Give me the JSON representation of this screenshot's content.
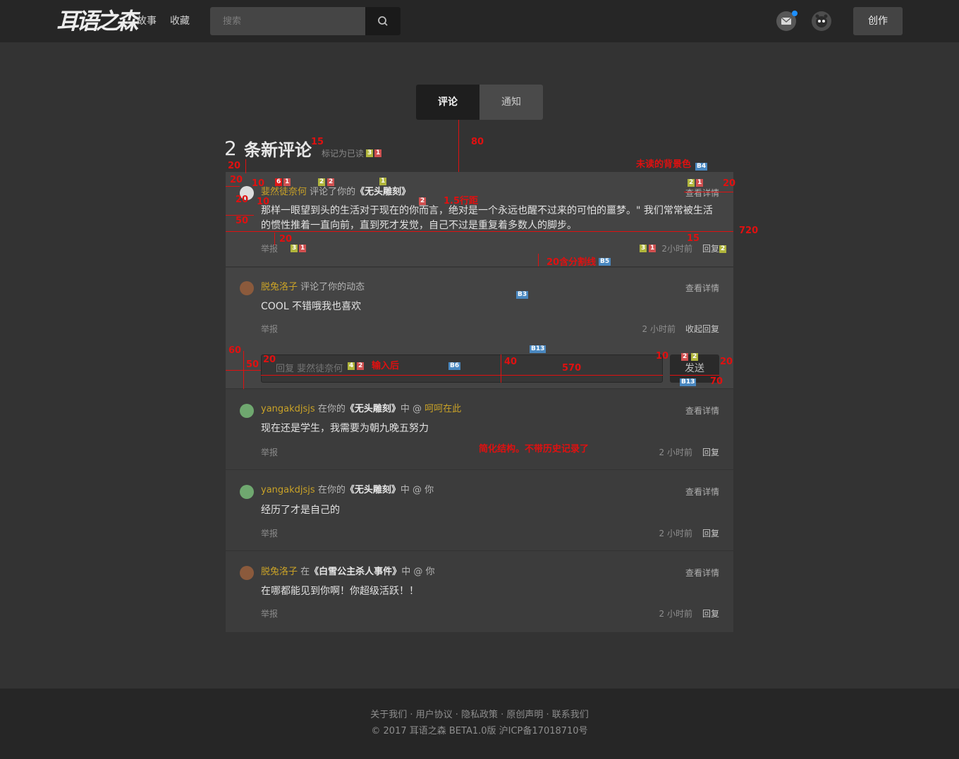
{
  "nav": {
    "logo": "耳语之森",
    "links": [
      "故事",
      "收藏"
    ],
    "search_placeholder": "搜索",
    "create_label": "创作"
  },
  "tabs": [
    "评论",
    "通知"
  ],
  "header": {
    "count": "2",
    "count_label": "条新评论",
    "mark_read": "标记为已读"
  },
  "comments": [
    {
      "user": "婓然徒奈何",
      "action": "评论了你的",
      "work": "《无头雕刻》",
      "detail": "查看详情",
      "body": "那样一眼望到头的生活对于现在的你而言，绝对是一个永远也醒不过来的可怕的噩梦。\" 我们常常被生活的惯性推着一直向前，直到死才发觉，自己不过是重复着多数人的脚步。",
      "report": "举报",
      "time": "2小时前",
      "reply": "回复"
    },
    {
      "user": "脱兔洛子",
      "action": "评论了你的动态",
      "detail": "查看详情",
      "body": "COOL 不错哦我也喜欢",
      "report": "举报",
      "time": "2 小时前",
      "reply": "收起回复",
      "reply_placeholder": "回复 婓然徒奈何",
      "send": "发送"
    },
    {
      "user": "yangakdjsjs",
      "prefix": "在你的",
      "work": "《无头雕刻》",
      "suffix": "中 @",
      "mention": "呵呵在此",
      "detail": "查看详情",
      "body": "现在还是学生，我需要为朝九晚五努力",
      "report": "举报",
      "time": "2 小时前",
      "reply": "回复"
    },
    {
      "user": "yangakdjsjs",
      "prefix": "在你的",
      "work": "《无头雕刻》",
      "suffix": "中 @ 你",
      "detail": "查看详情",
      "body": "经历了才是自己的",
      "report": "举报",
      "time": "2 小时前",
      "reply": "回复"
    },
    {
      "user": "脱兔洛子",
      "prefix": "在",
      "work": "《白雪公主杀人事件》",
      "suffix": "中 @ 你",
      "detail": "查看详情",
      "body": "在哪都能见到你啊！你超级活跃！！",
      "report": "举报",
      "time": "2 小时前",
      "reply": "回复"
    }
  ],
  "footer": {
    "links": "关于我们 · 用户协议 · 隐私政策 · 原创声明 · 联系我们",
    "copyright": "© 2017 耳语之森 BETA1.0版 沪ICP备17018710号"
  },
  "annotations": {
    "n15": "15",
    "n80": "80",
    "n20": "20",
    "n10": "10",
    "n50": "50",
    "n720": "720",
    "n60": "60",
    "n40": "40",
    "n570": "570",
    "n70": "70",
    "unread_bg": "未读的背景色",
    "line_height": "1.5行距",
    "divider": "20含分割线",
    "after_input": "输入后",
    "simplified": "简化结构。不带历史记录了",
    "b3": "B3",
    "b4": "B4",
    "b5": "B5",
    "b6": "B6",
    "b13": "B13",
    "d1": "1",
    "d2": "2",
    "d3": "3",
    "d4": "4",
    "d6": "6"
  },
  "colors": {
    "page_bg": "#333333",
    "nav_bg": "#262626",
    "unread_bg": "#444444",
    "read_bg": "#3c3c3c",
    "username": "#c9a227",
    "annotation": "#e01010",
    "notification_dot": "#1e90ff"
  }
}
